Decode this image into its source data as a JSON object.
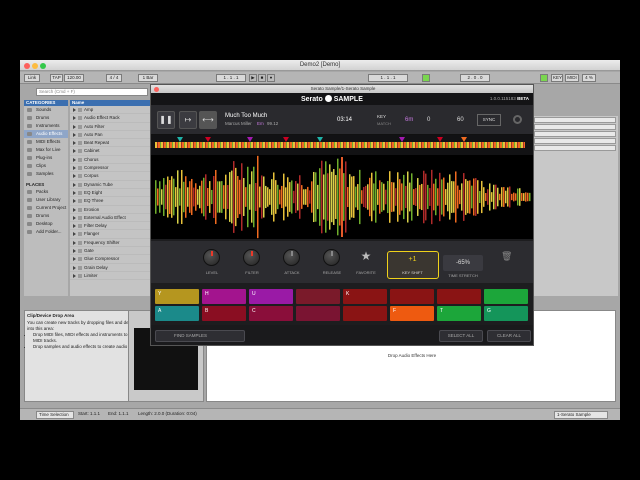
{
  "window": {
    "title": "Demo2 [Demo]"
  },
  "control_bar": {
    "link": "Link",
    "tap": "TAP",
    "tempo": "120.00",
    "signature": "4 / 4",
    "quantize": "1 Bar",
    "position": "1 . 1 . 1",
    "loop_end": "2 . 0 . 0",
    "key": "KEY",
    "midi": "MIDI",
    "cpu": "4 %"
  },
  "browser": {
    "search_placeholder": "Search (Cmd + F)",
    "categories_header": "CATEGORIES",
    "categories": [
      "Sounds",
      "Drums",
      "Instruments",
      "Audio Effects",
      "MIDI Effects",
      "Max for Live",
      "Plug-ins",
      "Clips",
      "Samples"
    ],
    "places_header": "PLACES",
    "places": [
      "Packs",
      "User Library",
      "Current Project",
      "Drums",
      "Desktop",
      "Add Folder..."
    ],
    "name_header": "Name",
    "items": [
      "Amp",
      "Audio Effect Rack",
      "Auto Filter",
      "Auto Pan",
      "Beat Repeat",
      "Cabinet",
      "Chorus",
      "Compressor",
      "Corpus",
      "Dynamic Tube",
      "EQ Eight",
      "EQ Three",
      "Erosion",
      "External Audio Effect",
      "Filter Delay",
      "Flanger",
      "Frequency Shifter",
      "Gate",
      "Glue Compressor",
      "Grain Delay",
      "Limiter"
    ]
  },
  "info": {
    "title": "Clip/Device Drop Area",
    "text": "You can create new tracks by dropping files and devices into this area:",
    "bullets": [
      "Drop MIDI files, MIDI effects and instruments to create MIDI tracks.",
      "Drop samples and audio effects to create audio tracks."
    ]
  },
  "device_area": {
    "drop_text": "Drop Audio Effects Here"
  },
  "status_bar": {
    "selection": "Time Selection",
    "start": "Start: 1.1.1",
    "end": "End: 1.1.1",
    "length": "Length: 2.0.0 (Duration: 0:04)",
    "track": "1-Serato Sample"
  },
  "plugin": {
    "title": "Serato Sample/1-Serato Sample",
    "brand": "Serato",
    "product": "SAMPLE",
    "version": "1.0.0.115183",
    "beta": "BETA",
    "track_title": "Much Too Much",
    "track_artist": "Marcus Miller",
    "track_key": "Em",
    "track_bpm": "99.12",
    "time": "03:14",
    "key_label": "KEY",
    "key_sub": "MATCH",
    "key_value": "6m",
    "pitch_value": "0",
    "bpm_value": "60",
    "sync": "SYNC",
    "knobs": [
      "LEVEL",
      "FILTER",
      "ATTACK",
      "RELEASE"
    ],
    "favorite": "FAVORITE",
    "key_shift_value": "+1",
    "key_shift_label": "KEY SHIFT",
    "time_stretch_value": "-65%",
    "time_stretch_label": "TIME STRETCH",
    "pads": [
      {
        "key": "Y",
        "color": "#b5961f"
      },
      {
        "key": "H",
        "color": "#a3148e"
      },
      {
        "key": "U",
        "color": "#9a1aa6"
      },
      {
        "key": "",
        "color": "#7a1a2a"
      },
      {
        "key": "K",
        "color": "#8a1414"
      },
      {
        "key": "",
        "color": "#8a1414"
      },
      {
        "key": "",
        "color": "#8a1414"
      },
      {
        "key": "",
        "color": "#1ca63a"
      },
      {
        "key": "A",
        "color": "#1b8a8a"
      },
      {
        "key": "B",
        "color": "#8a0e22"
      },
      {
        "key": "C",
        "color": "#8a0e3a"
      },
      {
        "key": "",
        "color": "#7a1432"
      },
      {
        "key": "",
        "color": "#8a1414"
      },
      {
        "key": "F",
        "color": "#ee5a10"
      },
      {
        "key": "T",
        "color": "#1ca63a"
      },
      {
        "key": "G",
        "color": "#14955a"
      }
    ],
    "find_samples": "FIND SAMPLES",
    "select_all": "SELECT ALL",
    "clear_all": "CLEAR ALL"
  }
}
